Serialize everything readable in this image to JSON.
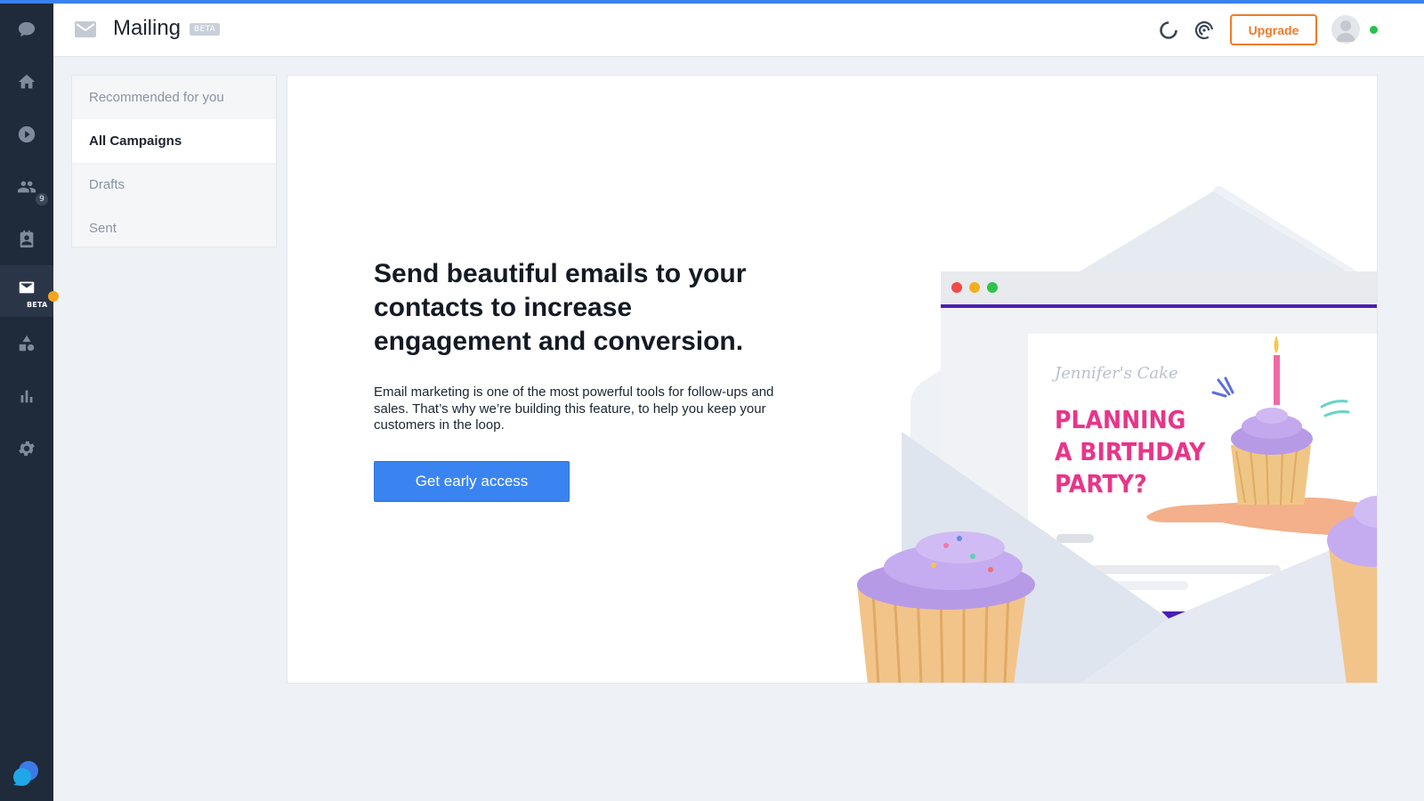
{
  "nav": {
    "items": [
      {
        "name": "chat-icon"
      },
      {
        "name": "home-icon"
      },
      {
        "name": "play-icon"
      },
      {
        "name": "contacts-icon",
        "badge": "9"
      },
      {
        "name": "address-book-icon"
      },
      {
        "name": "mailing-icon",
        "badge_text": "BETA"
      },
      {
        "name": "shapes-icon"
      },
      {
        "name": "bar-chart-icon"
      },
      {
        "name": "settings-icon"
      }
    ],
    "accent": "#f4a51c"
  },
  "header": {
    "title": "Mailing",
    "beta_label": "BETA",
    "upgrade_label": "Upgrade",
    "status_color": "#28c24a"
  },
  "subnav": {
    "items": [
      {
        "label": "Recommended for you"
      },
      {
        "label": "All Campaigns"
      },
      {
        "label": "Drafts"
      },
      {
        "label": "Sent"
      }
    ],
    "active_label": "All Campaigns"
  },
  "main": {
    "headline": "Send beautiful emails to your contacts to increase engagement and conversion.",
    "body": "Email marketing is one of the most powerful tools for follow-ups and sales. That’s why we’re building this feature, to help you keep your customers in the loop.",
    "cta_label": "Get early access",
    "cta_color": "#3a84f2"
  },
  "illustration": {
    "brand_text": "Jennifer's Cake",
    "headline_lines": [
      "PLANNING",
      "A BIRTHDAY",
      "PARTY?"
    ]
  }
}
